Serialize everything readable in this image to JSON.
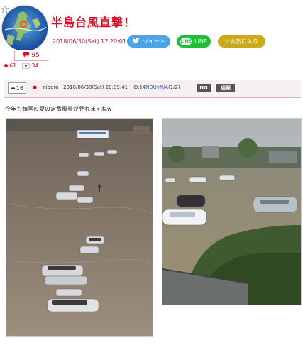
{
  "header": {
    "star_icon": "star-outline-icon",
    "title": "半島台風直撃！",
    "date": "2018/06/30(Sat) 17:20:01",
    "tweet_label": "ツイート",
    "line_label": "LINE",
    "line_logo_text": "LINE",
    "favorite_label": "☆お気に入り",
    "comment_count": "95",
    "reactions": [
      {
        "icon": "red-dot-icon",
        "count": "61"
      },
      {
        "icon": "korean-flag-icon",
        "count": "34"
      }
    ]
  },
  "post": {
    "reply_count": "16",
    "author": "nidaro",
    "timestamp": "2018/06/30(Sat) 20:09:41",
    "id_label": "ID:",
    "user_id": "k4NDUyNjA",
    "page": "(1/2)",
    "ng_label": "NG",
    "report_label": "通報",
    "body": "今年も韓国の夏の定番風景が見れますねw"
  },
  "colors": {
    "accent_red": "#d8112a",
    "twitter": "#4aa4e6",
    "line": "#1fbf37",
    "favorite": "#caa91b",
    "id_link": "#2f4fcf"
  }
}
